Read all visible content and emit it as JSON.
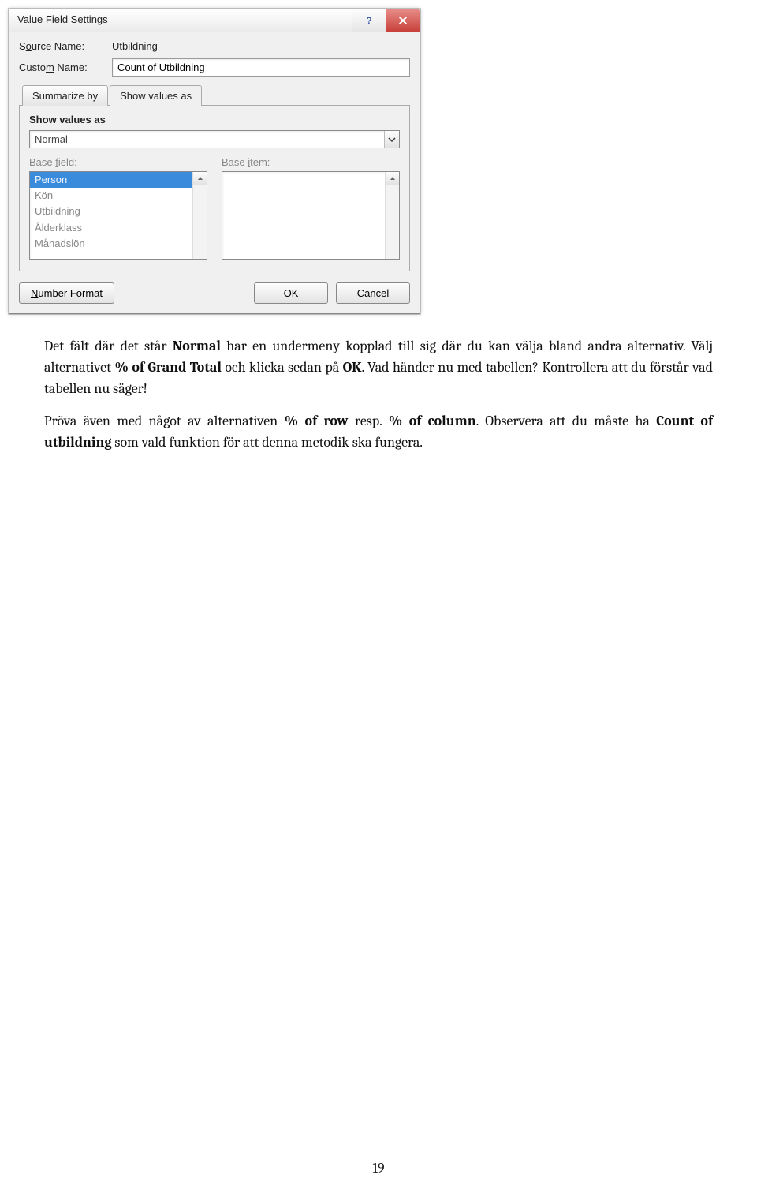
{
  "dialog": {
    "title": "Value Field Settings",
    "help_icon": "help-icon",
    "close_icon": "close-icon",
    "source_name_label_pre": "S",
    "source_name_label_u": "o",
    "source_name_label_post": "urce Name:",
    "source_name_value": "Utbildning",
    "custom_name_label_pre": "Custo",
    "custom_name_label_u": "m",
    "custom_name_label_post": " Name:",
    "custom_name_value": "Count of Utbildning",
    "tabs": {
      "summarize": "Summarize by",
      "showvalues": "Show values as"
    },
    "section_heading": "Show values as",
    "combo_value": "Normal",
    "base_field_label_pre": "Base ",
    "base_field_label_u": "f",
    "base_field_label_post": "ield:",
    "base_item_label_pre": "Base ",
    "base_item_label_u": "i",
    "base_item_label_post": "tem:",
    "base_field_items": [
      "Person",
      "Kön",
      "Utbildning",
      "Ålderklass",
      "Månadslön"
    ],
    "number_format_pre": "",
    "number_format_u": "N",
    "number_format_post": "umber Format",
    "ok": "OK",
    "cancel": "Cancel"
  },
  "prose": {
    "p1_a": "Det fält där det står ",
    "p1_b": "Normal",
    "p1_c": " har en undermeny kopplad till sig där du kan välja bland andra alternativ. Välj alternativet ",
    "p1_d": "% of Grand Total",
    "p1_e": " och klicka sedan på ",
    "p1_f": "OK",
    "p1_g": ". Vad händer nu med tabellen? Kontrollera att du förstår vad tabellen nu säger!",
    "p2_a": "Pröva även med något av alternativen ",
    "p2_b": "% of row",
    "p2_c": " resp. ",
    "p2_d": "% of column",
    "p2_e": ". Observera att du måste ha ",
    "p2_f": "Count of utbildning",
    "p2_g": " som vald funktion för att denna metodik ska fungera."
  },
  "page_number": "19"
}
